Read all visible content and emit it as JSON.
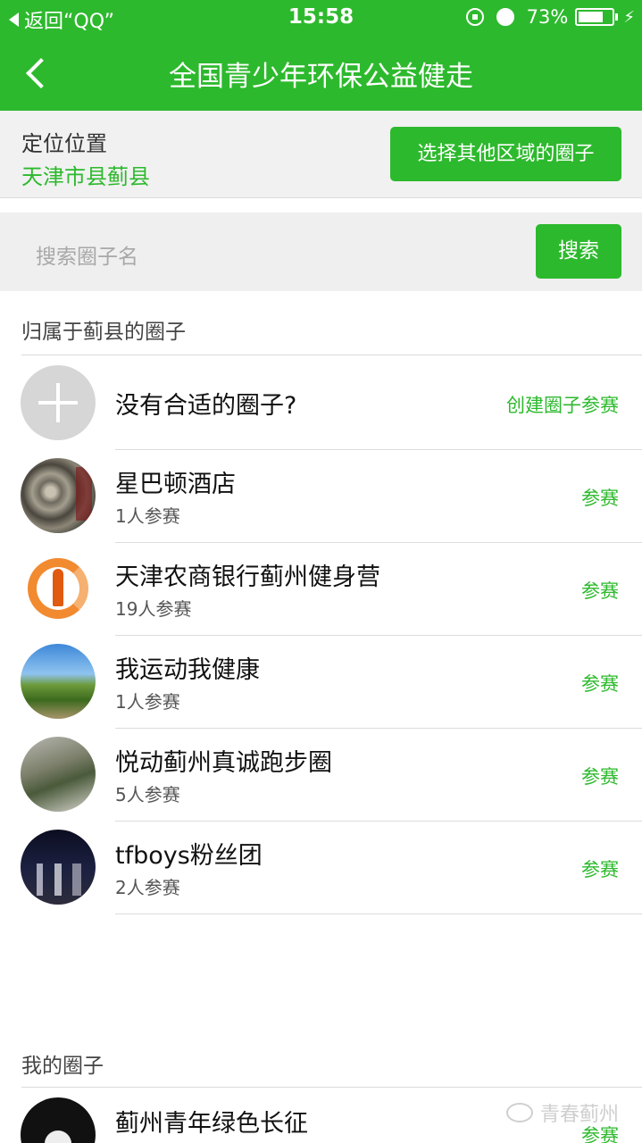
{
  "status_bar": {
    "back_app": "返回“QQ”",
    "time": "15:58",
    "battery_percent": "73%",
    "battery_level": 0.73
  },
  "navbar": {
    "title": "全国青少年环保公益健走"
  },
  "location": {
    "label": "定位位置",
    "value": "天津市县蓟县",
    "choose_button": "选择其他区域的圈子"
  },
  "search": {
    "placeholder": "搜索圈子名",
    "button": "搜索"
  },
  "circles_section": {
    "title": "归属于蓟县的圈子",
    "create_row": {
      "name": "没有合适的圈子?",
      "action": "创建圈子参赛"
    },
    "items": [
      {
        "name": "星巴顿酒店",
        "count": "1人参赛",
        "action": "参赛"
      },
      {
        "name": "天津农商银行蓟州健身营",
        "count": "19人参赛",
        "action": "参赛"
      },
      {
        "name": "我运动我健康",
        "count": "1人参赛",
        "action": "参赛"
      },
      {
        "name": "悦动蓟州真诚跑步圈",
        "count": "5人参赛",
        "action": "参赛"
      },
      {
        "name": "tfboys粉丝团",
        "count": "2人参赛",
        "action": "参赛"
      }
    ]
  },
  "my_section": {
    "title": "我的圈子",
    "items": [
      {
        "name": "蓟州青年绿色长征",
        "action": "参赛"
      }
    ]
  },
  "watermark": {
    "text": "青春蓟州"
  },
  "colors": {
    "accent": "#2db92d"
  }
}
